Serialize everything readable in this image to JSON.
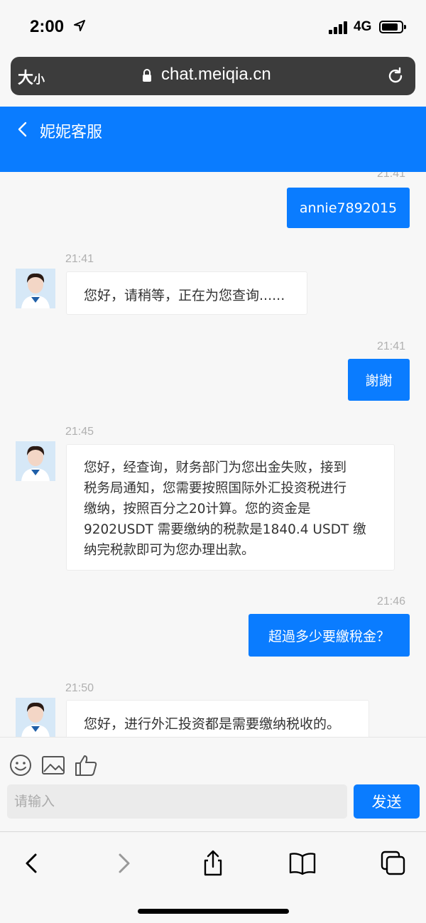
{
  "status": {
    "time": "2:00",
    "network": "4G"
  },
  "browser": {
    "text_size_big": "大",
    "text_size_small": "小",
    "url": "chat.meiqia.cn"
  },
  "header": {
    "title": "妮妮客服"
  },
  "messages": {
    "m1": {
      "time": "21:41",
      "text": "annie7892015"
    },
    "m2": {
      "time": "21:41",
      "text": "您好，请稍等，正在为您查询......"
    },
    "m3": {
      "time": "21:41",
      "text": "謝謝"
    },
    "m4": {
      "time": "21:45",
      "lines": [
        "您好，经查询，财务部门为您出金失败，接到",
        "税务局通知，您需要按照国际外汇投资税进行",
        "缴纳，按照百分之20计算。您的资金是",
        "9202USDT 需要缴纳的税款是1840.4 USDT 缴",
        "纳完税款即可为您办理出款。"
      ]
    },
    "m5": {
      "time": "21:46",
      "text": "超過多少要繳稅金？"
    },
    "m6": {
      "time": "21:50",
      "text": "您好，进行外汇投资都是需要缴纳税收的。"
    }
  },
  "composer": {
    "placeholder": "请输入",
    "send_label": "发送"
  },
  "colors": {
    "accent": "#0a7cff"
  },
  "icons": [
    "location-arrow-icon",
    "signal-icon",
    "battery-icon",
    "lock-icon",
    "reload-icon",
    "back-arrow-icon",
    "emoji-icon",
    "image-icon",
    "thumbs-up-icon",
    "safari-back-icon",
    "safari-forward-icon",
    "share-icon",
    "bookmarks-icon",
    "tabs-icon"
  ]
}
